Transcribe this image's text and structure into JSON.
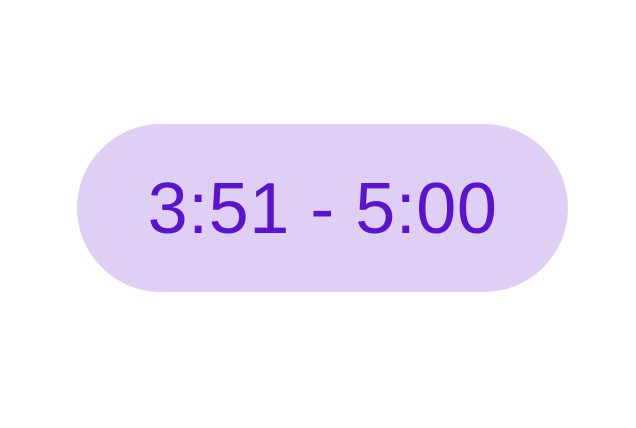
{
  "chip": {
    "label": "3:51 - 5:00",
    "background_color": "#dfcff5",
    "text_color": "#5a13cf"
  }
}
